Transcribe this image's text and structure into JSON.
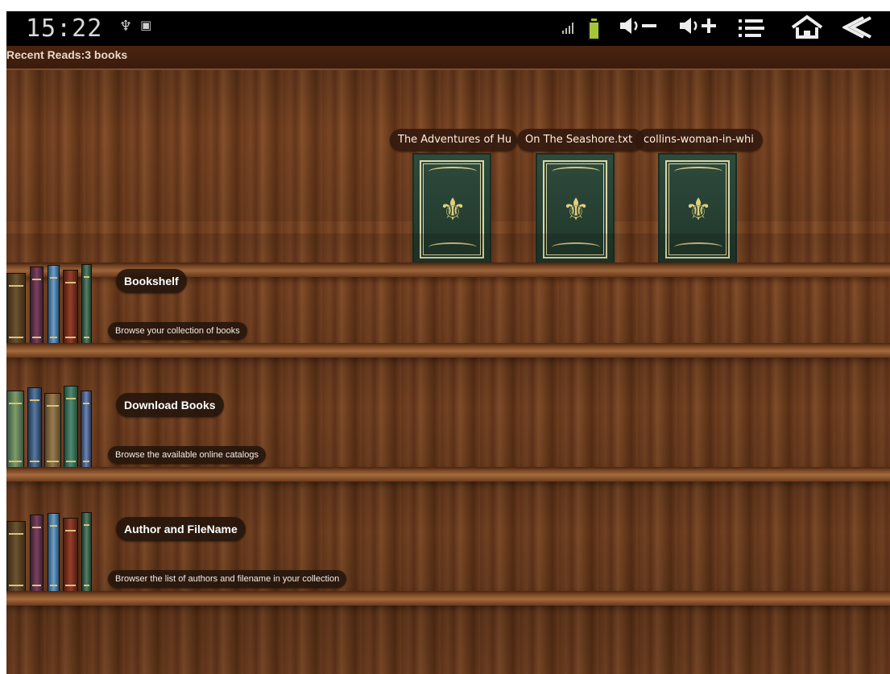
{
  "status_bar": {
    "time": "15:22",
    "icons": {
      "usb": "usb-icon",
      "debug": "debug-icon",
      "signal": "signal-icon",
      "battery": "battery-icon",
      "volume_down": "volume-down-icon",
      "volume_up": "volume-up-icon",
      "menu": "menu-icon",
      "home": "home-icon",
      "back": "back-icon"
    }
  },
  "recent_reads": {
    "title": "Recent Reads:3 books",
    "books": [
      {
        "title": "The Adventures of Hu"
      },
      {
        "title": "On The Seashore.txt"
      },
      {
        "title": "collins-woman-in-whi"
      }
    ]
  },
  "menu": {
    "items": [
      {
        "title": "Bookshelf",
        "description": "Browse your collection of books"
      },
      {
        "title": "Download Books",
        "description": "Browse the available online catalogs"
      },
      {
        "title": "Author and FileName",
        "description": "Browser the list of authors and filename in your collection"
      }
    ]
  },
  "colors": {
    "status_bar": "#000000",
    "wood_dark": "#4a2511",
    "wood_light": "#8a532d",
    "book_green": "#2e4b3d",
    "gold": "#ddd6a4"
  }
}
